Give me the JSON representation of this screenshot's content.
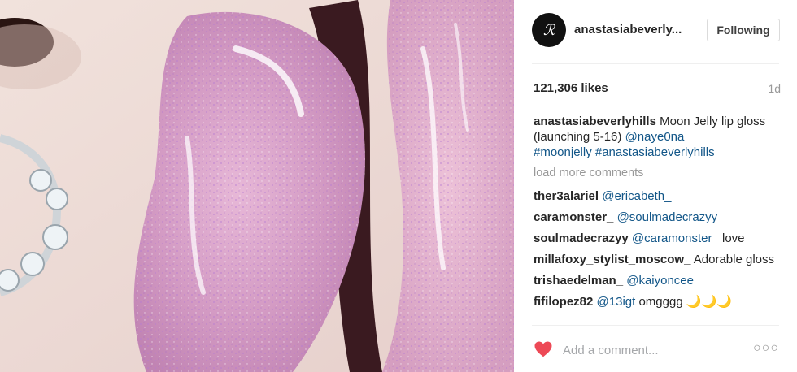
{
  "post": {
    "image_alt": "Glittery pink glossy lips with a jeweled nose ring",
    "username": "anastasiabeverly...",
    "follow_label": "Following",
    "likes": "121,306 likes",
    "age": "1d"
  },
  "caption": {
    "user": "anastasiabeverlyhills",
    "text_1": " Moon Jelly lip gloss (launching 5-16) ",
    "mention": "@naye0na",
    "hashtags": "#moonjelly #anastasiabeverlyhills"
  },
  "load_more": "load more comments",
  "comments": [
    {
      "user": "ther3alariel",
      "mention": "@ericabeth_",
      "text": ""
    },
    {
      "user": "caramonster_",
      "mention": "@soulmadecrazyy",
      "text": ""
    },
    {
      "user": "soulmadecrazyy",
      "mention": "@caramonster_",
      "text": " love"
    },
    {
      "user": "millafoxy_stylist_moscow_",
      "mention": "",
      "text": " Adorable gloss"
    },
    {
      "user": "trishaedelman_",
      "mention": "@kaiyoncee",
      "text": ""
    },
    {
      "user": "fifilopez82",
      "mention": "@13igt",
      "text": " omgggg 🌙🌙🌙"
    }
  ],
  "footer": {
    "comment_placeholder": "Add a comment...",
    "more_label": "○○○"
  },
  "colors": {
    "heart": "#ed4956",
    "link": "#125688",
    "muted": "#999999"
  },
  "icons": [
    "avatar-logo",
    "heart-icon",
    "more-options-icon"
  ]
}
